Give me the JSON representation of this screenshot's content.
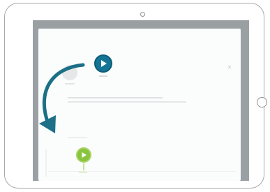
{
  "device": {
    "type": "tablet",
    "orientation": "landscape"
  },
  "status_bar": {
    "left_text": "",
    "right_text": ""
  },
  "dialog": {
    "primary_button": {
      "icon": "play-icon",
      "color": "#147596"
    },
    "target_button": {
      "icon": "play-icon",
      "color": "#89c43f"
    },
    "close_icon": "close-icon"
  },
  "annotation": {
    "arrow_color": "#1b6f86",
    "arrow_icon": "curved-arrow-icon"
  },
  "colors": {
    "screen_dim": "#9aa0a4",
    "dialog_bg": "#fbfcfc",
    "primary_blue": "#147596",
    "target_green": "#89c43f"
  }
}
